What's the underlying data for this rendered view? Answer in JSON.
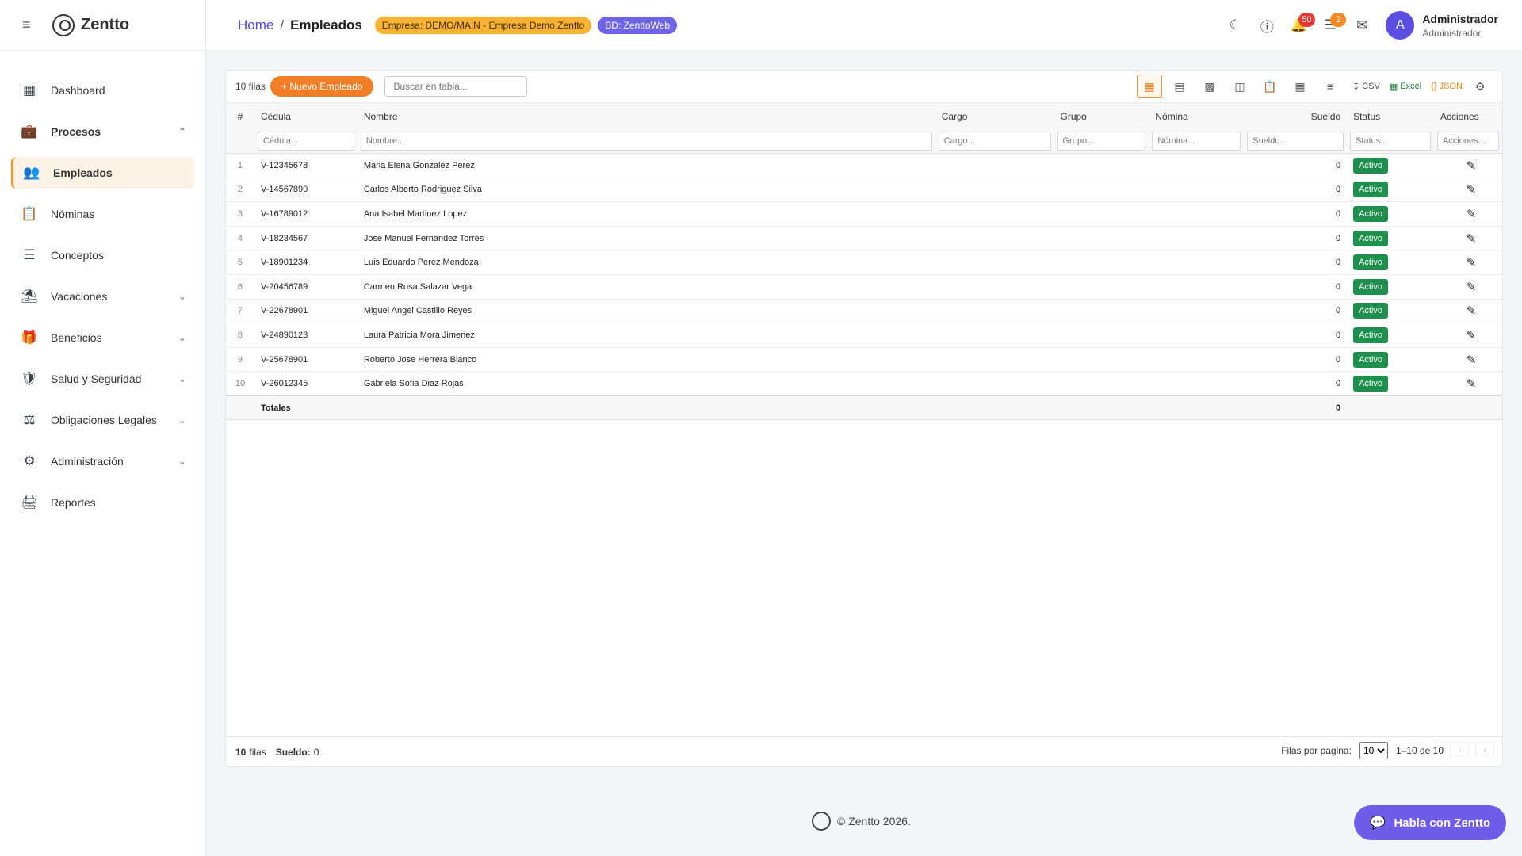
{
  "app": {
    "brand": "Zentto"
  },
  "sidebar": {
    "items": [
      {
        "label": "Dashboard",
        "icon": "dashboard-icon"
      },
      {
        "label": "Procesos",
        "icon": "briefcase-icon"
      },
      {
        "label": "Empleados",
        "icon": "people-icon"
      },
      {
        "label": "Nóminas",
        "icon": "badge-icon"
      },
      {
        "label": "Conceptos",
        "icon": "list-icon"
      },
      {
        "label": "Vacaciones",
        "icon": "beach-icon"
      },
      {
        "label": "Beneficios",
        "icon": "gift-icon"
      },
      {
        "label": "Salud y Seguridad",
        "icon": "shield-icon"
      },
      {
        "label": "Obligaciones Legales",
        "icon": "gavel-icon"
      },
      {
        "label": "Administración",
        "icon": "admin-icon"
      },
      {
        "label": "Reportes",
        "icon": "printer-icon"
      }
    ]
  },
  "header": {
    "breadcrumb_home": "Home",
    "breadcrumb_sep": "/",
    "breadcrumb_current": "Empleados",
    "chip_empresa": "Empresa: DEMO/MAIN - Empresa Demo Zentto",
    "chip_bd": "BD: ZenttoWeb",
    "notifications_count": "50",
    "tasks_count": "2",
    "avatar_letter": "A",
    "user_name": "Administrador",
    "user_role": "Administrador"
  },
  "toolbar": {
    "rows_label": "10 filas",
    "new_button": "+ Nuevo Empleado",
    "search_placeholder": "Buscar en tabla...",
    "csv": "CSV",
    "excel": "Excel",
    "json": "JSON"
  },
  "table": {
    "columns": {
      "num": "#",
      "cedula": "Cédula",
      "nombre": "Nombre",
      "cargo": "Cargo",
      "grupo": "Grupo",
      "nomina": "Nómina",
      "sueldo": "Sueldo",
      "status": "Status",
      "acciones": "Acciones"
    },
    "filters": {
      "cedula": "Cédula...",
      "nombre": "Nombre...",
      "cargo": "Cargo...",
      "grupo": "Grupo...",
      "nomina": "Nómina...",
      "sueldo": "Sueldo...",
      "status": "Status...",
      "acciones": "Acciones..."
    },
    "rows": [
      {
        "num": "1",
        "cedula": "V-12345678",
        "nombre": "Maria Elena Gonzalez Perez",
        "sueldo": "0",
        "status": "Activo"
      },
      {
        "num": "2",
        "cedula": "V-14567890",
        "nombre": "Carlos Alberto Rodriguez Silva",
        "sueldo": "0",
        "status": "Activo"
      },
      {
        "num": "3",
        "cedula": "V-16789012",
        "nombre": "Ana Isabel Martinez Lopez",
        "sueldo": "0",
        "status": "Activo"
      },
      {
        "num": "4",
        "cedula": "V-18234567",
        "nombre": "Jose Manuel Fernandez Torres",
        "sueldo": "0",
        "status": "Activo"
      },
      {
        "num": "5",
        "cedula": "V-18901234",
        "nombre": "Luis Eduardo Perez Mendoza",
        "sueldo": "0",
        "status": "Activo"
      },
      {
        "num": "6",
        "cedula": "V-20456789",
        "nombre": "Carmen Rosa Salazar Vega",
        "sueldo": "0",
        "status": "Activo"
      },
      {
        "num": "7",
        "cedula": "V-22678901",
        "nombre": "Miguel Angel Castillo Reyes",
        "sueldo": "0",
        "status": "Activo"
      },
      {
        "num": "8",
        "cedula": "V-24890123",
        "nombre": "Laura Patricia Mora Jimenez",
        "sueldo": "0",
        "status": "Activo"
      },
      {
        "num": "9",
        "cedula": "V-25678901",
        "nombre": "Roberto Jose Herrera Blanco",
        "sueldo": "0",
        "status": "Activo"
      },
      {
        "num": "10",
        "cedula": "V-26012345",
        "nombre": "Gabriela Sofia Diaz Rojas",
        "sueldo": "0",
        "status": "Activo"
      }
    ],
    "totals_label": "Totales",
    "totals_sueldo": "0"
  },
  "footer_bar": {
    "rows_count": "10",
    "rows_word": "filas",
    "sueldo_label": "Sueldo:",
    "sueldo_value": "0",
    "per_page_label": "Filas por pagina:",
    "per_page_value": "10",
    "range": "1–10 de 10"
  },
  "page_footer": {
    "copyright": "© Zentto 2026."
  },
  "chat": {
    "label": "Habla con Zentto"
  },
  "colors": {
    "accent": "#f07e26",
    "brand_purple": "#6f5ce8",
    "status_green": "#1f8f4e",
    "link_blue": "#4f46e5"
  }
}
